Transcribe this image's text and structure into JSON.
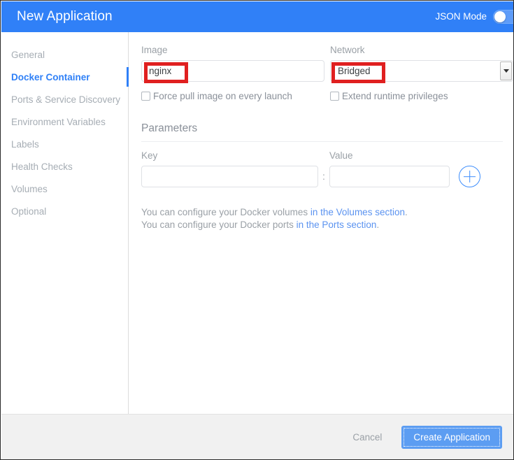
{
  "header": {
    "title": "New Application",
    "json_mode_label": "JSON Mode",
    "json_mode_enabled": false,
    "accent_color": "#3080f7"
  },
  "sidebar": {
    "items": [
      {
        "label": "General",
        "active": false
      },
      {
        "label": "Docker Container",
        "active": true
      },
      {
        "label": "Ports & Service Discovery",
        "active": false
      },
      {
        "label": "Environment Variables",
        "active": false
      },
      {
        "label": "Labels",
        "active": false
      },
      {
        "label": "Health Checks",
        "active": false
      },
      {
        "label": "Volumes",
        "active": false
      },
      {
        "label": "Optional",
        "active": false
      }
    ]
  },
  "main": {
    "image_field": {
      "label": "Image",
      "value": "nginx",
      "placeholder": ""
    },
    "network_field": {
      "label": "Network",
      "selected": "Bridged"
    },
    "force_pull_checkbox": {
      "label": "Force pull image on every launch",
      "checked": false
    },
    "extend_privileges_checkbox": {
      "label": "Extend runtime privileges",
      "checked": false
    },
    "parameters": {
      "title": "Parameters",
      "key_label": "Key",
      "value_label": "Value",
      "key_value": "",
      "value_value": "",
      "key_placeholder": "",
      "value_placeholder": "",
      "separator": ":",
      "add_icon": "plus-icon"
    },
    "help": {
      "line1_prefix": "You can configure your Docker volumes ",
      "line1_link": "in the Volumes section",
      "line1_suffix": ".",
      "line2_prefix": "You can configure your Docker ports ",
      "line2_link": "in the Ports section",
      "line2_suffix": "."
    }
  },
  "annotations": {
    "highlight_color": "#e02020",
    "boxes": [
      "image-input-value",
      "network-select-value"
    ]
  },
  "footer": {
    "cancel_label": "Cancel",
    "create_label": "Create Application"
  }
}
